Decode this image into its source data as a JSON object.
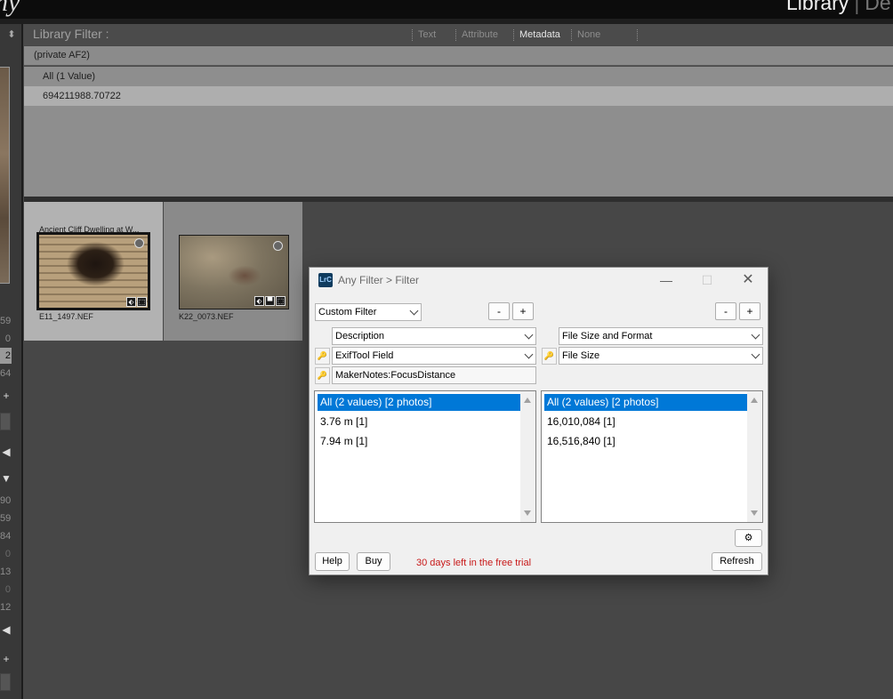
{
  "topbar": {
    "brand_fragment": "ny",
    "module": "Library",
    "module_sep": "|",
    "next_module": "De"
  },
  "left_panel": {
    "arrows": "⬍",
    "numbers": [
      "59",
      "0",
      "2",
      "64",
      "90",
      "59",
      "84",
      "0",
      "13",
      "0",
      "12"
    ],
    "plus_icons": [
      "+",
      "+"
    ],
    "play_icons": [
      "◀",
      "▼",
      "◀"
    ]
  },
  "filter_bar": {
    "title": "Library Filter :",
    "tabs": [
      "Text",
      "Attribute",
      "Metadata",
      "None"
    ],
    "active_tab": "Metadata"
  },
  "metadata_browser": {
    "column_header": "(private AF2)",
    "rows": [
      "All (1 Value)",
      "694211988.70722"
    ]
  },
  "grid": {
    "cells": [
      {
        "title": "Ancient Cliff Dwelling at W...",
        "filename": "E11_1497.NEF",
        "icons": [
          "⬖",
          "⬚"
        ]
      },
      {
        "title": "",
        "filename": "K22_0073.NEF",
        "icons": [
          "⬖",
          "▀",
          "⬚"
        ]
      }
    ]
  },
  "dialog": {
    "logo": "LrC",
    "title": "Any Filter > Filter",
    "window_controls": {
      "minimize": "—",
      "maximize": "☐",
      "close": "✕"
    },
    "preset": "Custom Filter",
    "minus": "-",
    "plus": "+",
    "left": {
      "field1": "Description",
      "field2": "ExifTool Field",
      "tag": "MakerNotes:FocusDistance",
      "values": [
        "All (2 values) [2 photos]",
        "3.76 m [1]",
        "7.94 m [1]"
      ]
    },
    "right": {
      "field1": "File Size and Format",
      "field2": "File Size",
      "values": [
        "All (2 values) [2 photos]",
        "16,010,084 [1]",
        "16,516,840 [1]"
      ]
    },
    "pin_icon": "🔑",
    "gear_icon": "⚙",
    "help": "Help",
    "buy": "Buy",
    "trial": "30 days left in the free trial",
    "refresh": "Refresh"
  }
}
